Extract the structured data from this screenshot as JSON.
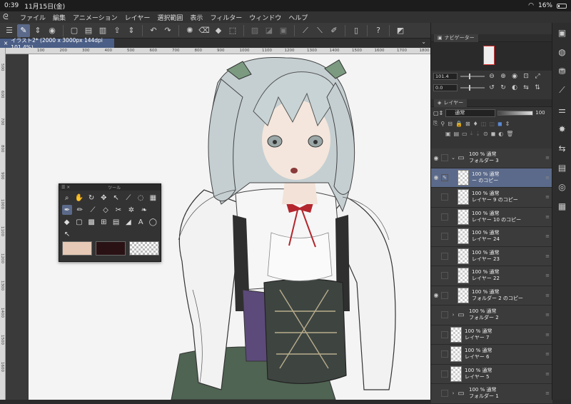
{
  "status": {
    "time": "0:39",
    "date": "11月15日(金)",
    "battery": "16%"
  },
  "menu": [
    "ファイル",
    "編集",
    "アニメーション",
    "レイヤー",
    "選択範囲",
    "表示",
    "フィルター",
    "ウィンドウ",
    "ヘルプ"
  ],
  "document_tab": "イラスト2* (2000 x 3000px 144dpi 101.4%)",
  "ruler_top": [
    "100",
    "200",
    "300",
    "400",
    "500",
    "600",
    "700",
    "800",
    "900",
    "1000",
    "1100",
    "1200",
    "1300",
    "1400",
    "1500",
    "1600",
    "1700",
    "1800"
  ],
  "ruler_left": [
    "500",
    "600",
    "700",
    "800",
    "900",
    "1000",
    "1100",
    "1200",
    "1300",
    "1400",
    "1500",
    "1600"
  ],
  "tool_palette": {
    "title": "ツール"
  },
  "colors": {
    "main": "#e6c9b6",
    "sub": "#2a1214",
    "accent": "#5b6a8a"
  },
  "navigator": {
    "title": "ナビゲーター",
    "zoom": "101.4",
    "angle": "0.0"
  },
  "layer_panel": {
    "title": "レイヤー",
    "blend_mode": "通常",
    "opacity": "100"
  },
  "layers": [
    {
      "opacity": "100 % 通常",
      "name": "フォルダー 3",
      "kind": "folder",
      "expanded": true,
      "visible": true,
      "indent": 1
    },
    {
      "opacity": "100 % 通常",
      "name": "ー のコピー",
      "kind": "raster",
      "visible": true,
      "selected": true,
      "indent": 2
    },
    {
      "opacity": "100 % 通常",
      "name": "レイヤー 9 のコピー",
      "kind": "raster",
      "visible": false,
      "indent": 2
    },
    {
      "opacity": "100 % 通常",
      "name": "レイヤー 10 のコピー",
      "kind": "raster",
      "visible": false,
      "indent": 2
    },
    {
      "opacity": "100 % 通常",
      "name": "レイヤー 24",
      "kind": "raster",
      "visible": false,
      "indent": 2
    },
    {
      "opacity": "100 % 通常",
      "name": "レイヤー 23",
      "kind": "raster",
      "visible": false,
      "indent": 2
    },
    {
      "opacity": "100 % 通常",
      "name": "レイヤー 22",
      "kind": "raster",
      "visible": false,
      "indent": 2
    },
    {
      "opacity": "100 % 通常",
      "name": "フォルダー 2 のコピー",
      "kind": "raster",
      "visible": true,
      "indent": 2
    },
    {
      "opacity": "100 % 通常",
      "name": "フォルダー 2",
      "kind": "folder",
      "expanded": false,
      "visible": false,
      "indent": 1
    },
    {
      "opacity": "100 % 通常",
      "name": "レイヤー 7",
      "kind": "raster",
      "visible": false,
      "indent": 1
    },
    {
      "opacity": "100 % 通常",
      "name": "レイヤー 6",
      "kind": "raster",
      "visible": false,
      "indent": 1
    },
    {
      "opacity": "100 % 通常",
      "name": "レイヤー 5",
      "kind": "raster",
      "visible": false,
      "indent": 1
    },
    {
      "opacity": "100 % 通常",
      "name": "フォルダー 1",
      "kind": "folder",
      "expanded": false,
      "visible": false,
      "indent": 1
    }
  ]
}
